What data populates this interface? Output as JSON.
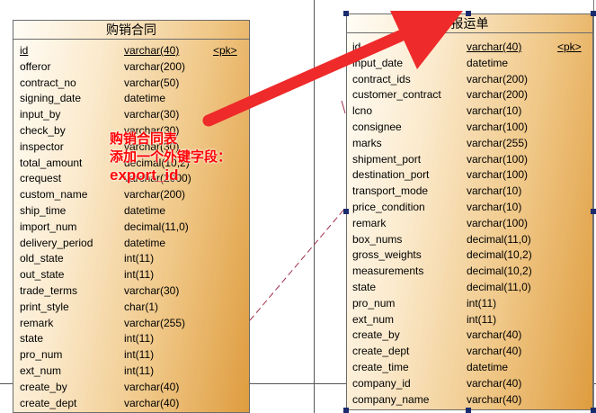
{
  "left_table": {
    "title": "购销合同",
    "rows": [
      {
        "name": "id",
        "type": "varchar(40)",
        "key": "<pk>"
      },
      {
        "name": "offeror",
        "type": "varchar(200)",
        "key": ""
      },
      {
        "name": "contract_no",
        "type": "varchar(50)",
        "key": ""
      },
      {
        "name": "signing_date",
        "type": "datetime",
        "key": ""
      },
      {
        "name": "input_by",
        "type": "varchar(30)",
        "key": ""
      },
      {
        "name": "check_by",
        "type": "varchar(30)",
        "key": ""
      },
      {
        "name": "inspector",
        "type": "varchar(30)",
        "key": ""
      },
      {
        "name": "total_amount",
        "type": "decimal(10,2)",
        "key": ""
      },
      {
        "name": "crequest",
        "type": "varchar(2000)",
        "key": ""
      },
      {
        "name": "custom_name",
        "type": "varchar(200)",
        "key": ""
      },
      {
        "name": "ship_time",
        "type": "datetime",
        "key": ""
      },
      {
        "name": "import_num",
        "type": "decimal(11,0)",
        "key": ""
      },
      {
        "name": "delivery_period",
        "type": "datetime",
        "key": ""
      },
      {
        "name": "old_state",
        "type": "int(11)",
        "key": ""
      },
      {
        "name": "out_state",
        "type": "int(11)",
        "key": ""
      },
      {
        "name": "trade_terms",
        "type": "varchar(30)",
        "key": ""
      },
      {
        "name": "print_style",
        "type": "char(1)",
        "key": ""
      },
      {
        "name": "remark",
        "type": "varchar(255)",
        "key": ""
      },
      {
        "name": "state",
        "type": "int(11)",
        "key": ""
      },
      {
        "name": "pro_num",
        "type": "int(11)",
        "key": ""
      },
      {
        "name": "ext_num",
        "type": "int(11)",
        "key": ""
      },
      {
        "name": "create_by",
        "type": "varchar(40)",
        "key": ""
      },
      {
        "name": "create_dept",
        "type": "varchar(40)",
        "key": ""
      }
    ]
  },
  "right_table": {
    "title": "报运单",
    "rows": [
      {
        "name": "id",
        "type": "varchar(40)",
        "key": "<pk>"
      },
      {
        "name": "input_date",
        "type": "datetime",
        "key": ""
      },
      {
        "name": "contract_ids",
        "type": "varchar(200)",
        "key": ""
      },
      {
        "name": "customer_contract",
        "type": "varchar(200)",
        "key": ""
      },
      {
        "name": "lcno",
        "type": "varchar(10)",
        "key": ""
      },
      {
        "name": "consignee",
        "type": "varchar(100)",
        "key": ""
      },
      {
        "name": "marks",
        "type": "varchar(255)",
        "key": ""
      },
      {
        "name": "shipment_port",
        "type": "varchar(100)",
        "key": ""
      },
      {
        "name": "destination_port",
        "type": "varchar(100)",
        "key": ""
      },
      {
        "name": "transport_mode",
        "type": "varchar(10)",
        "key": ""
      },
      {
        "name": "price_condition",
        "type": "varchar(10)",
        "key": ""
      },
      {
        "name": "remark",
        "type": "varchar(100)",
        "key": ""
      },
      {
        "name": "box_nums",
        "type": "decimal(11,0)",
        "key": ""
      },
      {
        "name": "gross_weights",
        "type": "decimal(10,2)",
        "key": ""
      },
      {
        "name": "measurements",
        "type": "decimal(10,2)",
        "key": ""
      },
      {
        "name": "state",
        "type": "decimal(11,0)",
        "key": ""
      },
      {
        "name": "pro_num",
        "type": "int(11)",
        "key": ""
      },
      {
        "name": "ext_num",
        "type": "int(11)",
        "key": ""
      },
      {
        "name": "create_by",
        "type": "varchar(40)",
        "key": ""
      },
      {
        "name": "create_dept",
        "type": "varchar(40)",
        "key": ""
      },
      {
        "name": "create_time",
        "type": "datetime",
        "key": ""
      },
      {
        "name": "company_id",
        "type": "varchar(40)",
        "key": ""
      },
      {
        "name": "company_name",
        "type": "varchar(40)",
        "key": ""
      }
    ]
  },
  "annotation": {
    "line1": "购销合同表",
    "line2": "添加一个外键字段：",
    "line3": "export_id"
  },
  "colors": {
    "arrow": "#ee2a2a",
    "annotation_text": "#ff0000",
    "relation_line": "#a0304a",
    "selection_handle": "#1a2a6e"
  }
}
